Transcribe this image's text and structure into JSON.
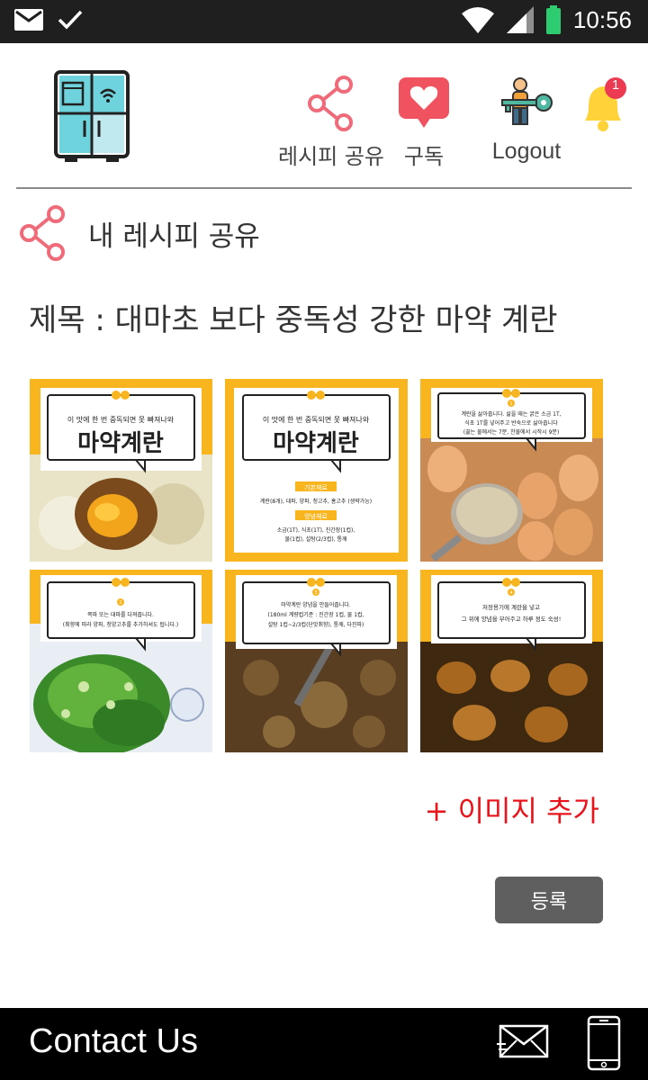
{
  "status_bar": {
    "time": "10:56"
  },
  "nav": {
    "share_label": "레시피 공유",
    "subscribe_label": "구독",
    "logout_label": "Logout",
    "notification_count": "1"
  },
  "section": {
    "title": "내 레시피 공유"
  },
  "recipe": {
    "title": "제목 : 대마초 보다 중독성 강한 마약 계란",
    "images": [
      {
        "heading": "이 맛에 한 번 중독되면 못 빠져나와",
        "big": "마약계란"
      },
      {
        "heading": "이 맛에 한 번 중독되면 못 빠져나와",
        "big": "마약계란",
        "basic_label": "기본재료",
        "basic": "계란(8개), 대파, 양파, 청고추, 홍고추 (생략가능)",
        "sauce_label": "양념재료",
        "sauce1": "소금(1T), 식초(1T), 진간장(1컵),",
        "sauce2": "물(1컵), 설탕(2/3컵), 통깨"
      },
      {
        "step": "1",
        "line1": "계란을 삶아줍니다. 삶을 때는 굵은 소금 1T,",
        "line2": "식초 1T를 넣어주고 반숙으로 삶아줍니다",
        "line3": "(끓는 물에서는 7분, 찬물에서 시작시 9분)"
      },
      {
        "step": "2",
        "line1": "쪽파 또는 대파를 다져줍니다.",
        "line2": "(취향에 따라 양파, 청양고추를 추가하셔도 됩니다.)"
      },
      {
        "step": "3",
        "line1": "마약계란 양념을 만들어줍니다.",
        "line2": "(180ml 계량컵기준 : 진간장 1컵, 물 1컵,",
        "line3": "설탕 1컵~2/3컵(단맛취향), 통깨, 다진파)"
      },
      {
        "step": "4",
        "line1": "저장용기에 계란을 넣고",
        "line2": "그 위에 양념을 부어주고 하루 정도 숙성!"
      }
    ],
    "add_image_label": "+ 이미지 추가",
    "register_label": "등록"
  },
  "footer": {
    "contact_label": "Contact Us"
  },
  "colors": {
    "accent_red": "#e8141c",
    "tile_yellow": "#f9b51e",
    "share_pink": "#f06b7a",
    "footer_bg": "#000000",
    "button_gray": "#5f5f5f"
  }
}
